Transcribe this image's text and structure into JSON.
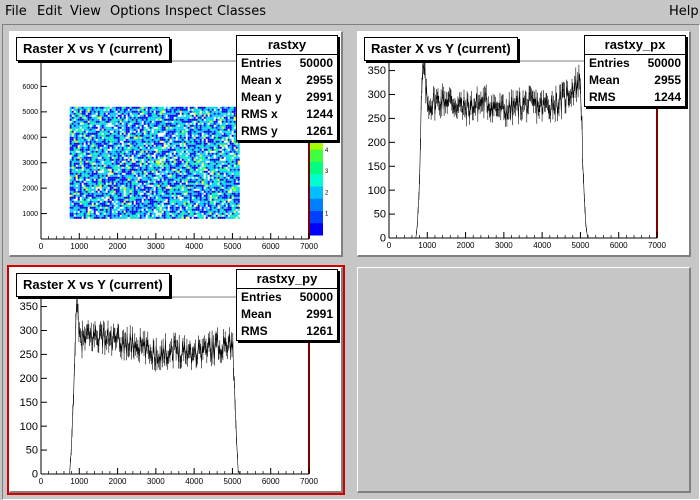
{
  "menubar": {
    "items": [
      {
        "label": "File"
      },
      {
        "label": "Edit"
      },
      {
        "label": "View"
      },
      {
        "label": "Options"
      },
      {
        "label": "Inspect"
      },
      {
        "label": "Classes"
      }
    ],
    "help": "Help"
  },
  "pads": [
    {
      "title": "Raster X vs Y (current)",
      "stats": {
        "name": "rastxy",
        "rows": [
          [
            "Entries",
            "50000"
          ],
          [
            "Mean x",
            "2955"
          ],
          [
            "Mean y",
            "2991"
          ],
          [
            "RMS x",
            "1244"
          ],
          [
            "RMS y",
            "1261"
          ]
        ]
      }
    },
    {
      "title": "Raster X vs Y (current)",
      "stats": {
        "name": "rastxy_px",
        "rows": [
          [
            "Entries",
            "50000"
          ],
          [
            "Mean",
            "2955"
          ],
          [
            "RMS",
            "1244"
          ]
        ]
      }
    },
    {
      "title": "Raster X vs Y (current)",
      "stats": {
        "name": "rastxy_py",
        "rows": [
          [
            "Entries",
            "50000"
          ],
          [
            "Mean",
            "2991"
          ],
          [
            "RMS",
            "1261"
          ]
        ]
      }
    }
  ],
  "chart_data": [
    {
      "type": "heatmap",
      "title": "Raster X vs Y (current)",
      "xlim": [
        0,
        7000
      ],
      "ylim": [
        0,
        7000
      ],
      "x_ticks": [
        0,
        1000,
        2000,
        3000,
        4000,
        5000,
        6000,
        7000
      ],
      "y_ticks": [
        1000,
        2000,
        3000,
        4000,
        5000,
        6000
      ],
      "x_range_filled": [
        750,
        5150
      ],
      "y_range_filled": [
        800,
        5200
      ],
      "colorbar_ticks": [
        1,
        2,
        3,
        4
      ],
      "palette": [
        "#0000ff",
        "#00c8ff",
        "#00ff96",
        "#ffff00"
      ]
    },
    {
      "type": "line",
      "title": "Raster X vs Y (current)",
      "xlim": [
        0,
        7000
      ],
      "ylim": [
        0,
        370
      ],
      "x_ticks": [
        0,
        1000,
        2000,
        3000,
        4000,
        5000,
        6000,
        7000
      ],
      "y_ticks": [
        0,
        50,
        100,
        150,
        200,
        250,
        300,
        350
      ],
      "x": [
        700,
        750,
        800,
        850,
        900,
        1000,
        1500,
        2000,
        2500,
        3000,
        3500,
        4000,
        4500,
        5000,
        5050,
        5100,
        5150,
        5200
      ],
      "y": [
        0,
        40,
        120,
        300,
        360,
        280,
        290,
        270,
        285,
        265,
        280,
        275,
        285,
        330,
        200,
        80,
        15,
        0
      ]
    },
    {
      "type": "line",
      "title": "Raster X vs Y (current)",
      "xlim": [
        0,
        7000
      ],
      "ylim": [
        0,
        370
      ],
      "x_ticks": [
        0,
        1000,
        2000,
        3000,
        4000,
        5000,
        6000,
        7000
      ],
      "y_ticks": [
        0,
        50,
        100,
        150,
        200,
        250,
        300,
        350
      ],
      "x": [
        750,
        800,
        850,
        900,
        950,
        1000,
        1500,
        2000,
        2500,
        3000,
        3500,
        4000,
        4500,
        5000,
        5050,
        5100,
        5150,
        5200
      ],
      "y": [
        0,
        60,
        180,
        300,
        350,
        280,
        290,
        275,
        270,
        250,
        260,
        255,
        265,
        275,
        180,
        90,
        10,
        0
      ]
    }
  ]
}
